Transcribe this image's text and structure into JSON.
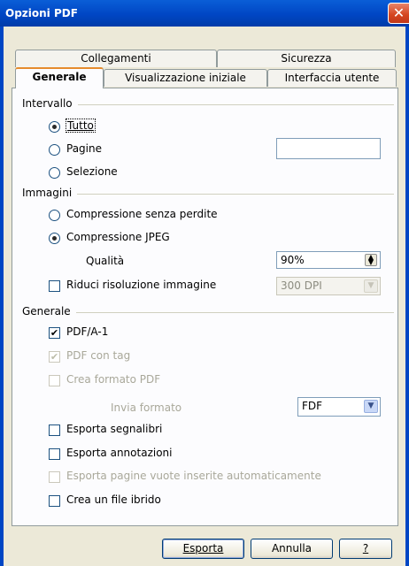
{
  "window": {
    "title": "Opzioni PDF",
    "close": "✕"
  },
  "tabs": {
    "back": [
      "Collegamenti",
      "Sicurezza"
    ],
    "front": [
      "Generale",
      "Visualizzazione iniziale",
      "Interfaccia utente"
    ],
    "active": "Generale"
  },
  "range": {
    "label": "Intervallo",
    "options": [
      "Tutto",
      "Pagine",
      "Selezione"
    ],
    "selected": "Tutto",
    "pages_value": ""
  },
  "images": {
    "label": "Immagini",
    "lossless": "Compressione senza perdite",
    "jpeg": "Compressione JPEG",
    "selected": "Compressione JPEG",
    "quality_label": "Qualità",
    "quality_value": "90%",
    "reduce_label": "Riduci risoluzione immagine",
    "resolution_value": "300 DPI"
  },
  "general": {
    "label": "Generale",
    "pdfa": "PDF/A-1",
    "tagged": "PDF con tag",
    "create_form": "Crea formato PDF",
    "submit_format_label": "Invia formato",
    "submit_format_value": "FDF",
    "bookmarks": "Esporta segnalibri",
    "notes": "Esporta annotazioni",
    "blank_pages": "Esporta pagine vuote inserite automaticamente",
    "hybrid": "Crea un file ibrido"
  },
  "buttons": {
    "export": "Esporta",
    "cancel": "Annulla",
    "help": "?"
  },
  "colors": {
    "titlebar": "#0046c4",
    "dialog_bg": "#ece9d8",
    "tab_accent": "#e68b2c",
    "close": "#d4441f"
  }
}
